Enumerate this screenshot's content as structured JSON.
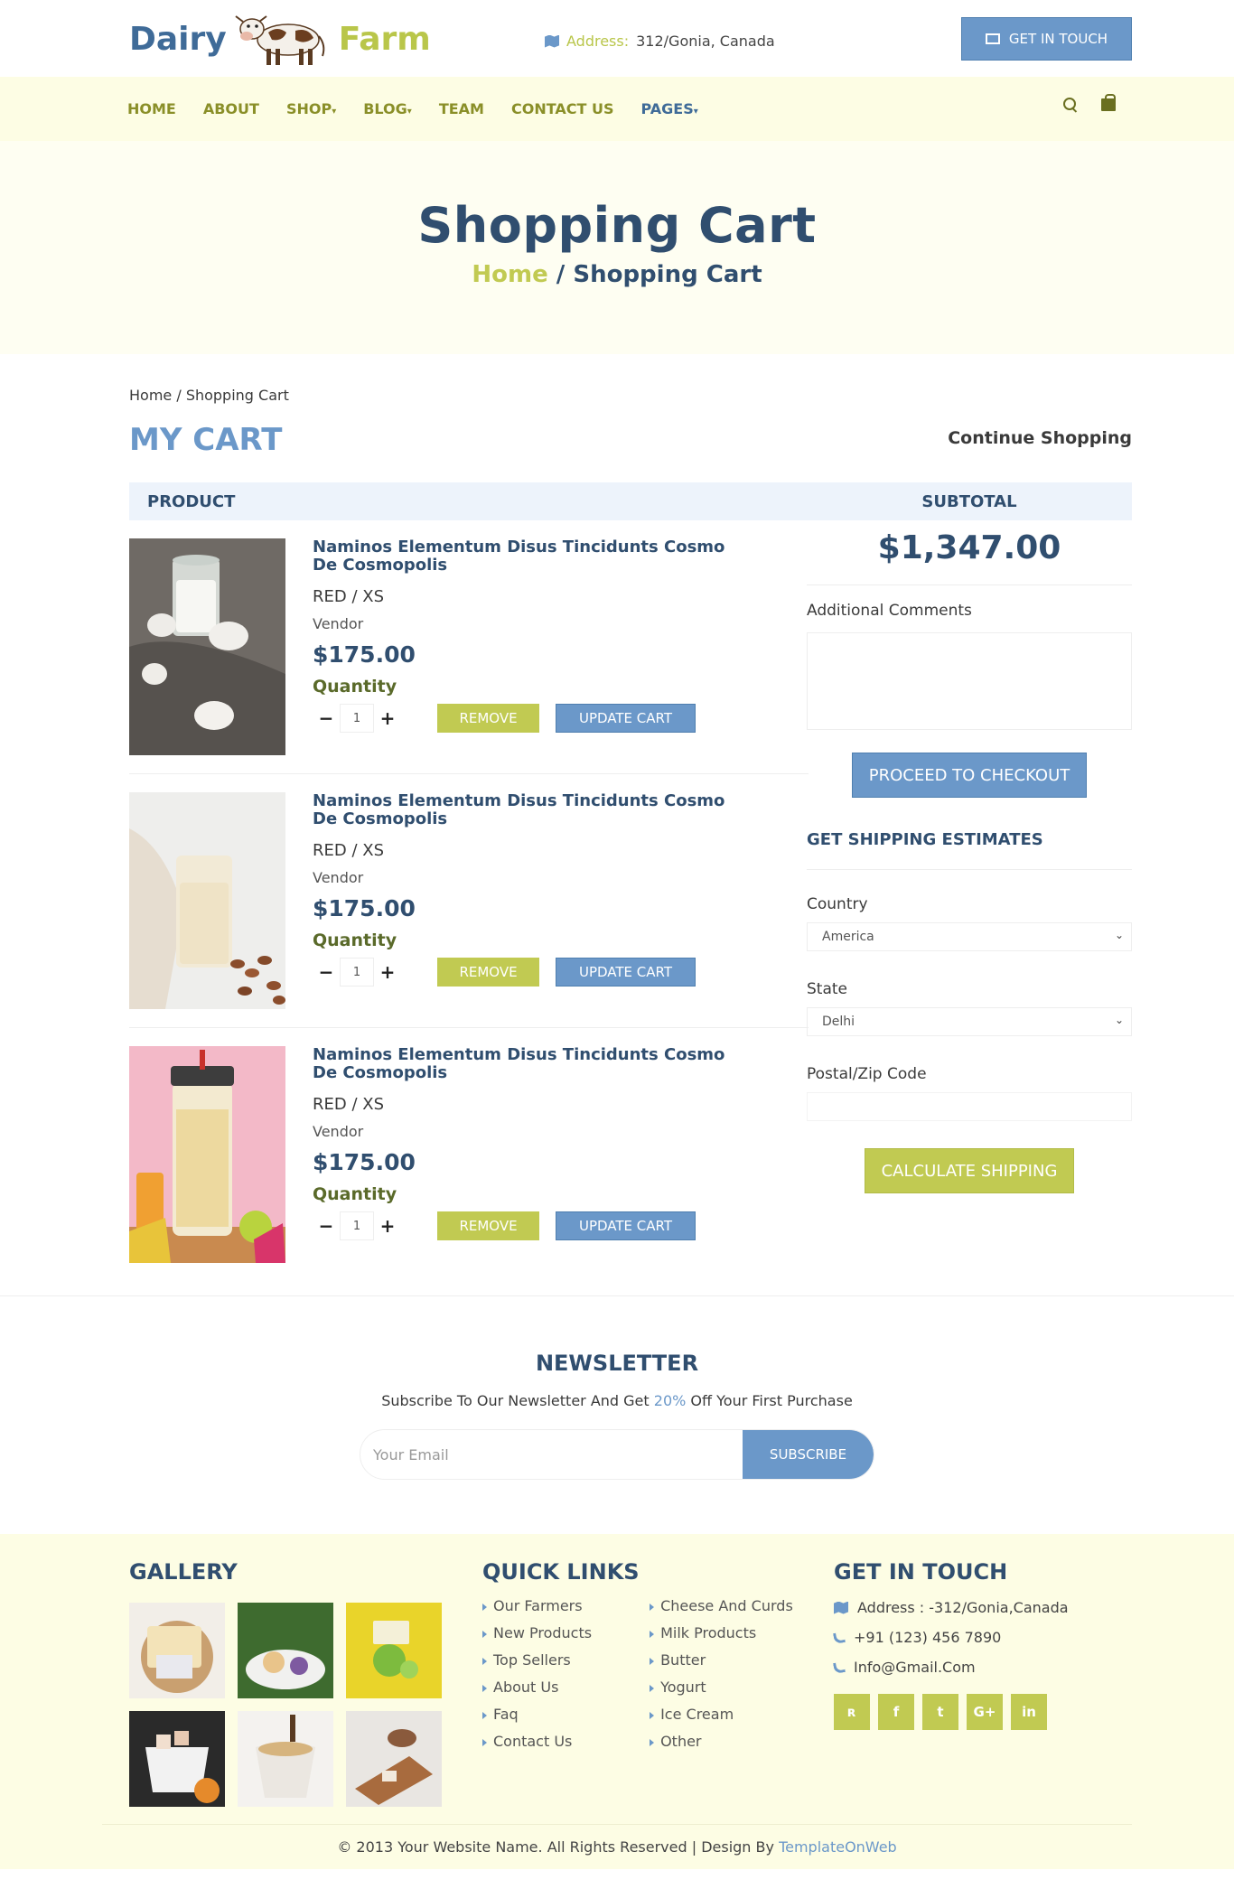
{
  "brand": {
    "word1": "Dairy",
    "word2": "Farm"
  },
  "header": {
    "address_label": "Address:",
    "address_value": "312/Gonia, Canada",
    "touch_button": "GET IN TOUCH"
  },
  "nav": {
    "items": [
      {
        "label": "HOME",
        "caret": ""
      },
      {
        "label": "ABOUT",
        "caret": ""
      },
      {
        "label": "SHOP",
        "caret": "▾"
      },
      {
        "label": "BLOG",
        "caret": "▾"
      },
      {
        "label": "TEAM",
        "caret": ""
      },
      {
        "label": "CONTACT US",
        "caret": ""
      },
      {
        "label": "PAGES",
        "caret": "▾"
      }
    ]
  },
  "banner": {
    "title": "Shopping Cart",
    "crumb_home": "Home",
    "crumb_sep": "/",
    "crumb_current": "Shopping Cart"
  },
  "breadcrumb": "Home / Shopping Cart",
  "cart": {
    "title": "MY CART",
    "continue": "Continue Shopping",
    "product_header": "PRODUCT",
    "subtotal_header": "SUBTOTAL",
    "subtotal_value": "$1,347.00",
    "items": [
      {
        "name": "Naminos Elementum Disus Tincidunts Cosmo De Cosmopolis",
        "variant": "RED / XS",
        "vendor": "Vendor",
        "price": "$175.00",
        "qty_label": "Quantity",
        "qty": "1",
        "remove": "REMOVE",
        "update": "UPDATE CART"
      },
      {
        "name": "Naminos Elementum Disus Tincidunts Cosmo De Cosmopolis",
        "variant": "RED / XS",
        "vendor": "Vendor",
        "price": "$175.00",
        "qty_label": "Quantity",
        "qty": "1",
        "remove": "REMOVE",
        "update": "UPDATE CART"
      },
      {
        "name": "Naminos Elementum Disus Tincidunts Cosmo De Cosmopolis",
        "variant": "RED / XS",
        "vendor": "Vendor",
        "price": "$175.00",
        "qty_label": "Quantity",
        "qty": "1",
        "remove": "REMOVE",
        "update": "UPDATE CART"
      }
    ],
    "minus": "−",
    "plus": "+"
  },
  "sidebar": {
    "comments_label": "Additional Comments",
    "checkout": "PROCEED TO CHECKOUT",
    "shipping_title": "GET SHIPPING ESTIMATES",
    "country_label": "Country",
    "country_value": "America",
    "state_label": "State",
    "state_value": "Delhi",
    "zip_label": "Postal/Zip Code",
    "calc": "CALCULATE SHIPPING"
  },
  "newsletter": {
    "title": "NEWSLETTER",
    "text_pre": "Subscribe To Our Newsletter And Get",
    "text_pct": "20%",
    "text_post": "Off Your First Purchase",
    "placeholder": "Your Email",
    "button": "SUBSCRIBE"
  },
  "footer": {
    "gallery_title": "GALLERY",
    "links_title": "QUICK LINKS",
    "links_col1": [
      "Our Farmers",
      "New Products",
      "Top Sellers",
      "About Us",
      "Faq",
      "Contact Us"
    ],
    "links_col2": [
      "Cheese And Curds",
      "Milk Products",
      "Butter",
      "Yogurt",
      "Ice Cream",
      "Other"
    ],
    "contact_title": "GET IN TOUCH",
    "address": "Address : -312/Gonia,Canada",
    "phone": "+91 (123) 456 7890",
    "email": "Info@Gmail.Com",
    "socials": [
      "rss",
      "f",
      "t",
      "G+",
      "in"
    ],
    "copyright_pre": "© 2013 Your Website Name. All Rights Reserved | Design By",
    "copyright_link": "TemplateOnWeb"
  },
  "colors": {
    "blue": "#6b98c9",
    "navy": "#304e6f",
    "lime": "#c1ca52",
    "cream": "#fdfde4"
  }
}
